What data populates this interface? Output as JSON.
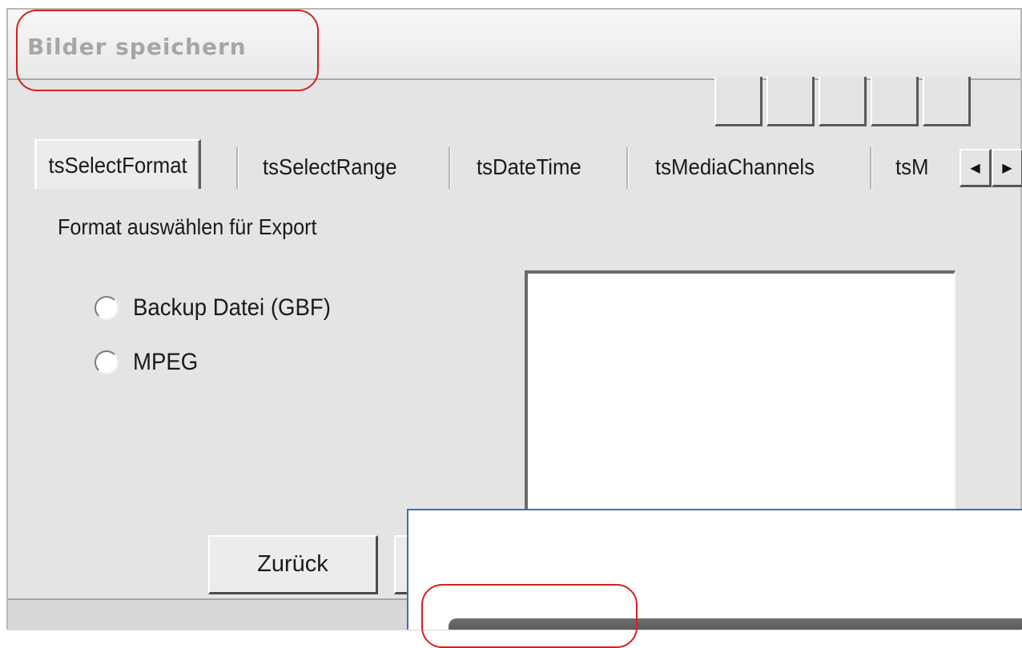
{
  "window": {
    "title": "Bilder speichern"
  },
  "tabs": [
    {
      "label": "tsSelectFormat",
      "selected": true
    },
    {
      "label": "tsSelectRange",
      "selected": false
    },
    {
      "label": "tsDateTime",
      "selected": false
    },
    {
      "label": "tsMediaChannels",
      "selected": false
    },
    {
      "label": "tsM",
      "selected": false
    }
  ],
  "tab_scroll": {
    "left_icon": "arrow-left-icon",
    "right_icon": "arrow-right-icon"
  },
  "content": {
    "heading": "Format auswählen für Export",
    "options": [
      {
        "label": "Backup Datei (GBF)",
        "checked": false
      },
      {
        "label": "MPEG",
        "checked": false
      }
    ]
  },
  "buttons": {
    "back": "Zurück"
  },
  "colors": {
    "highlight_ring": "#d42020",
    "overlay_border": "#3d6fb3"
  }
}
